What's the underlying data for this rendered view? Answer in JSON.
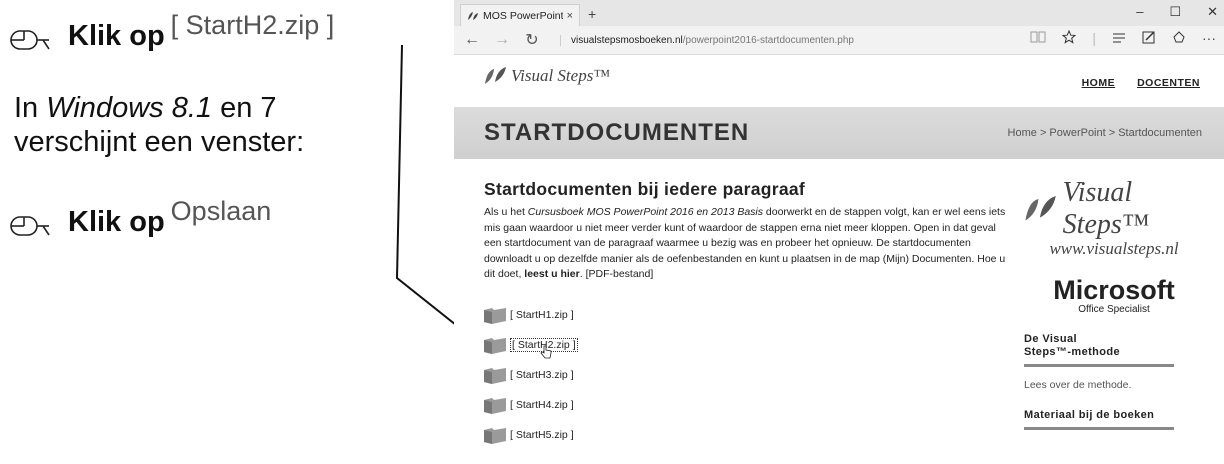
{
  "instructions": {
    "step1": {
      "verb": "Klik op",
      "target": "[ StartH2.zip ]"
    },
    "paragraph": {
      "prefix": "In ",
      "os_name": "Windows 8.1",
      "mid": " en 7",
      "line2": "verschijnt een venster:"
    },
    "step2": {
      "verb": "Klik op",
      "target": "Opslaan"
    }
  },
  "browser": {
    "tab_title": "MOS PowerPoint Startdc",
    "tab_close": "×",
    "new_tab": "+",
    "window_controls": [
      "–",
      "☐",
      "✕"
    ],
    "nav": {
      "back": "←",
      "forward": "→",
      "refresh": "↻"
    },
    "url": {
      "domain": "visualstepsmosboeken.nl",
      "path": "/powerpoint2016-startdocumenten.php"
    },
    "toolbar_icons": [
      "reading-view-icon",
      "favorite-star-icon",
      "hub-icon",
      "web-note-icon",
      "share-icon",
      "more-icon"
    ]
  },
  "site": {
    "logo_text": "Visual Steps™",
    "nav": [
      "HOME",
      "DOCENTEN"
    ],
    "banner_title": "STARTDOCUMENTEN",
    "breadcrumb": "Home > PowerPoint > Startdocumenten",
    "section_title": "Startdocumenten bij iedere paragraaf",
    "intro": {
      "p1": "Als u het ",
      "book": "Cursusboek MOS PowerPoint 2016 en 2013 Basis",
      "p2": " doorwerkt en de stappen volgt, kan er wel eens iets mis gaan waardoor u niet meer verder kunt of waardoor de stappen erna niet meer kloppen. Open in dat geval een startdocument van de paragraaf waarmee u bezig was en probeer het opnieuw. De startdocumenten downloadt u op dezelfde manier als de oefenbestanden en kunt u plaatsen in de map (Mijn) Documenten. Hoe u dit doet, ",
      "link": "leest u hier",
      "p3": ". [PDF-bestand]"
    },
    "files": [
      "[ StartH1.zip ]",
      "[ StartH2.zip ]",
      "[ StartH3.zip ]",
      "[ StartH4.zip ]",
      "[ StartH5.zip ]"
    ],
    "sidebar": {
      "brand": "Visual Steps™",
      "url": "www.visualsteps.nl",
      "ms_logo": "Microsoft",
      "ms_sub": "Office Specialist",
      "method_title_1": "De Visual",
      "method_title_2": "Steps™-methode",
      "method_link": "Lees over de methode.",
      "materials_title": "Materiaal bij de boeken"
    }
  },
  "colors": {
    "banner": "#d4d4d4",
    "chrome": "#e6e6e6",
    "text": "#222222"
  }
}
